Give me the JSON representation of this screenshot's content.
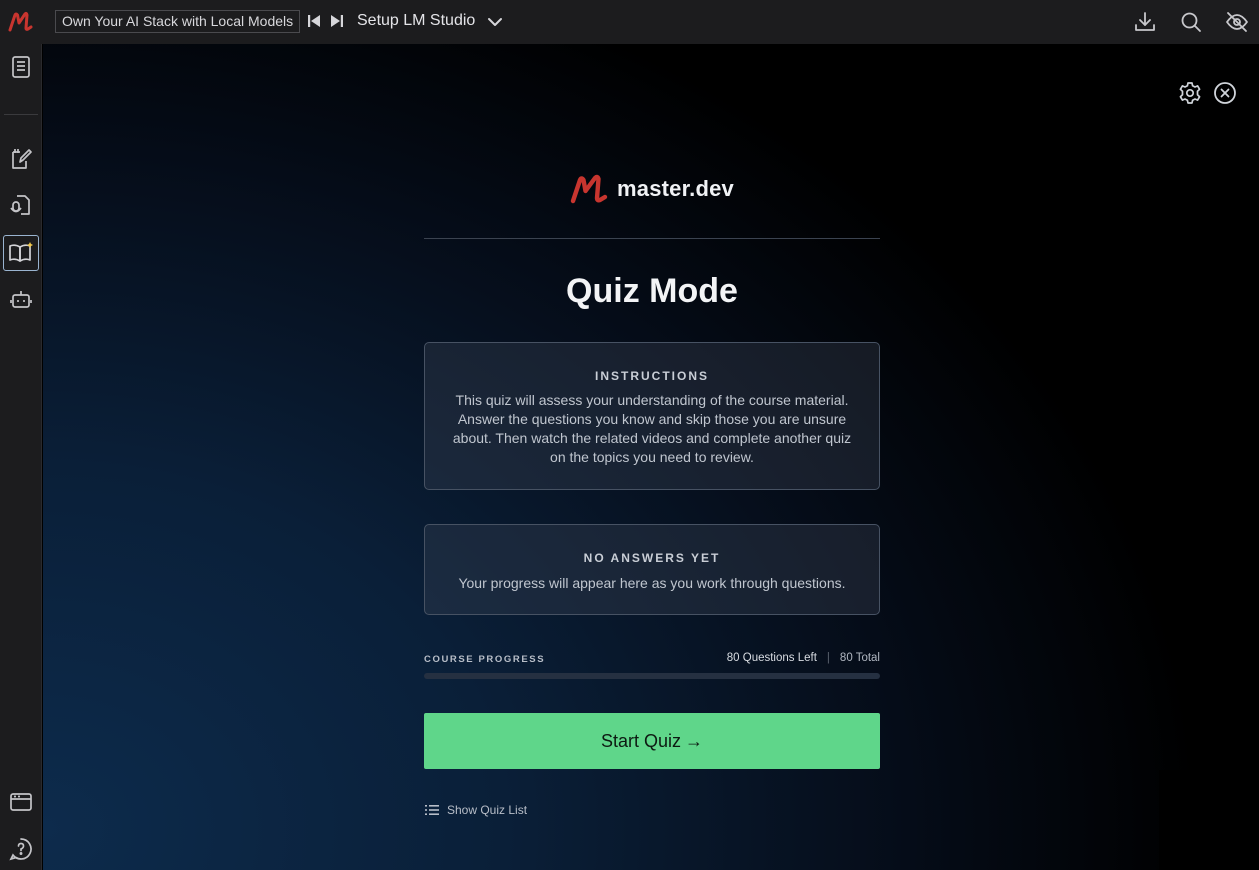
{
  "topbar": {
    "course_title": "Own Your AI Stack with Local Models",
    "lesson_title": "Setup LM Studio",
    "brand_color": "#c8352f",
    "icons": [
      "skip-previous-icon",
      "skip-next-icon",
      "chevron-down-icon",
      "download-icon",
      "search-icon",
      "eye-off-icon"
    ]
  },
  "sidebar": {
    "items": [
      {
        "name": "notes-icon"
      },
      {
        "name": "edit-notes-icon"
      },
      {
        "name": "mic-transcript-icon"
      },
      {
        "name": "quiz-book-icon",
        "active": true
      },
      {
        "name": "bot-icon"
      },
      {
        "name": "browser-window-icon"
      },
      {
        "name": "help-icon"
      }
    ]
  },
  "main": {
    "logo_text": "master.dev",
    "title": "Quiz Mode",
    "instructions": {
      "heading": "INSTRUCTIONS",
      "body": "This quiz will assess your understanding of the course material. Answer the questions you know and skip those you are unsure about. Then watch the related videos and complete another quiz on the topics you need to review."
    },
    "no_answers": {
      "heading": "NO ANSWERS YET",
      "body": "Your progress will appear here as you work through questions."
    },
    "progress": {
      "label": "COURSE PROGRESS",
      "questions_left": "80 Questions Left",
      "separator": "|",
      "total": "80 Total",
      "fraction_complete": 0
    },
    "start_button": "Start Quiz",
    "start_arrow": "→",
    "show_quiz_list": "Show Quiz List",
    "accent_color": "#5fd68a"
  }
}
